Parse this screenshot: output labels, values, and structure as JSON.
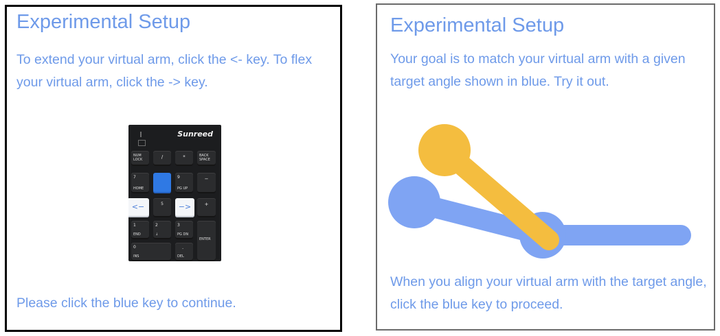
{
  "left_panel": {
    "title": "Experimental Setup",
    "instruction": "To extend your virtual arm, click the <- key. To flex your virtual arm, click the -> key.",
    "footer": "Please click the blue key to continue.",
    "keypad": {
      "brand": "Sunreed",
      "highlight_color": "#2f79e4",
      "keys": {
        "numlock": [
          "NUM",
          "LOCK"
        ],
        "slash": "/",
        "star": "*",
        "backspace": [
          "BACK",
          "SPACE"
        ],
        "k7": [
          "7",
          "HOME"
        ],
        "k9": [
          "9",
          "PG UP"
        ],
        "minus": "−",
        "left_arrow": "<−",
        "k5": "5",
        "right_arrow": "−>",
        "plus": "+",
        "k1": [
          "1",
          "END"
        ],
        "k2": [
          "2",
          "↓"
        ],
        "k3": [
          "3",
          "PG DN"
        ],
        "enter": "ENTER",
        "k0": [
          "0",
          "INS"
        ],
        "dot": [
          ".",
          "DEL"
        ]
      }
    }
  },
  "right_panel": {
    "title": "Experimental Setup",
    "goal": "Your goal is to match your virtual arm with a given target angle shown in blue. Try it out.",
    "footer": "When you align your virtual arm with the target angle, click the blue key to proceed.",
    "colors": {
      "target_arm": "#7fa4f3",
      "virtual_arm": "#f4bd3f"
    }
  },
  "colors": {
    "text": "#6e9ae9"
  }
}
